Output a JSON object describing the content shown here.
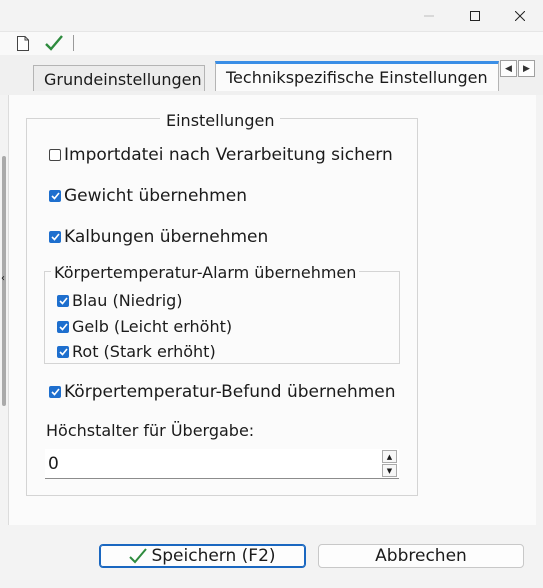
{
  "window": {
    "minimize_icon": "minimize-icon",
    "maximize_icon": "maximize-icon",
    "close_icon": "close-icon"
  },
  "toolbar": {
    "new_icon": "new-document-icon",
    "confirm_icon": "checkmark-icon"
  },
  "tabs": [
    {
      "label": "Grundeinstellungen",
      "active": false
    },
    {
      "label": "Technikspezifische Einstellungen",
      "active": true
    }
  ],
  "tab_scroll": {
    "left_icon": "arrow-left-icon",
    "right_icon": "arrow-right-icon"
  },
  "settings": {
    "group_title": "Einstellungen",
    "import_backup": {
      "label": "Importdatei nach Verarbeitung sichern",
      "checked": false
    },
    "weight": {
      "label": "Gewicht übernehmen",
      "checked": true
    },
    "calvings": {
      "label": "Kalbungen übernehmen",
      "checked": true
    },
    "temp_alarm": {
      "title": "Körpertemperatur-Alarm übernehmen",
      "options": [
        {
          "label": "Blau (Niedrig)",
          "checked": true
        },
        {
          "label": "Gelb (Leicht erhöht)",
          "checked": true
        },
        {
          "label": "Rot (Stark erhöht)",
          "checked": true
        }
      ]
    },
    "temp_finding": {
      "label": "Körpertemperatur-Befund übernehmen",
      "checked": true
    },
    "max_age": {
      "label": "Höchstalter für Übergabe:",
      "value": "0"
    }
  },
  "buttons": {
    "save": "Speichern (F2)",
    "cancel": "Abbrechen"
  },
  "colors": {
    "accent": "#1e6fce",
    "tab_highlight": "#3a8ee6",
    "confirm_green": "#2e8b3e"
  }
}
